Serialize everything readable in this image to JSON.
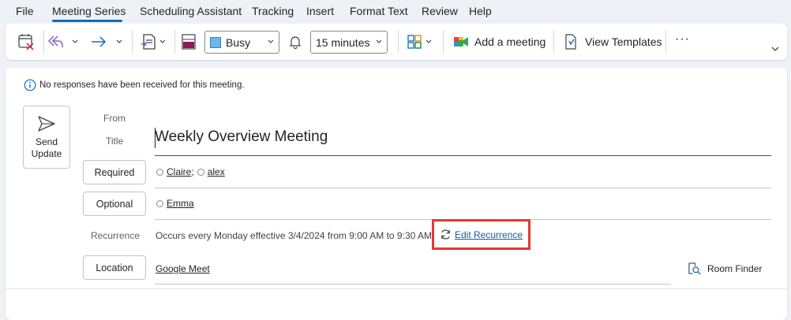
{
  "menu": {
    "tabs": [
      "File",
      "Meeting Series",
      "Scheduling Assistant",
      "Tracking",
      "Insert",
      "Format Text",
      "Review",
      "Help"
    ],
    "active": "Meeting Series"
  },
  "ribbon": {
    "show_as": "Busy",
    "reminder": "15 minutes",
    "add_meeting_label": "Add a meeting",
    "view_templates_label": "View Templates",
    "more_label": "···",
    "show_as_color": "#6fb5e8",
    "category_color": "#8b1a5a"
  },
  "info_bar": {
    "text": "No responses have been received for this meeting."
  },
  "send": {
    "line1": "Send",
    "line2": "Update"
  },
  "form": {
    "from_label": "From",
    "title_label": "Title",
    "title_value": "Weekly Overview Meeting",
    "required_label": "Required",
    "required_attendees": [
      "Claire",
      "alex"
    ],
    "optional_label": "Optional",
    "optional_attendees": [
      "Emma"
    ],
    "recurrence_label": "Recurrence",
    "recurrence_text": "Occurs every Monday effective 3/4/2024 from 9:00 AM to 9:30 AM",
    "edit_recurrence_label": "Edit Recurrence",
    "location_label": "Location",
    "location_value": "Google Meet",
    "room_finder_label": "Room Finder"
  },
  "colors": {
    "accent": "#0f6cbd",
    "highlight_box": "#e53935",
    "link": "#115ea3"
  }
}
